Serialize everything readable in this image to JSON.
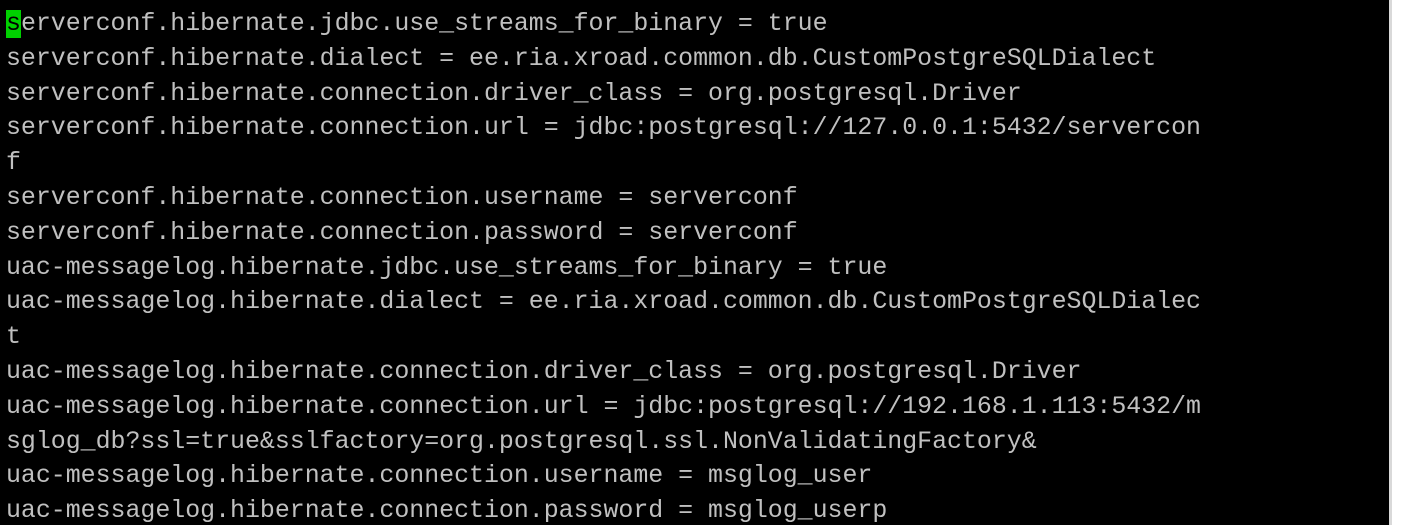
{
  "terminal": {
    "cursor_char": "s",
    "lines": [
      "erverconf.hibernate.jdbc.use_streams_for_binary = true",
      "serverconf.hibernate.dialect = ee.ria.xroad.common.db.CustomPostgreSQLDialect",
      "serverconf.hibernate.connection.driver_class = org.postgresql.Driver",
      "serverconf.hibernate.connection.url = jdbc:postgresql://127.0.0.1:5432/servercon",
      "f",
      "serverconf.hibernate.connection.username = serverconf",
      "serverconf.hibernate.connection.password = serverconf",
      "uac-messagelog.hibernate.jdbc.use_streams_for_binary = true",
      "uac-messagelog.hibernate.dialect = ee.ria.xroad.common.db.CustomPostgreSQLDialec",
      "t",
      "uac-messagelog.hibernate.connection.driver_class = org.postgresql.Driver",
      "uac-messagelog.hibernate.connection.url = jdbc:postgresql://192.168.1.113:5432/m",
      "sglog_db?ssl=true&sslfactory=org.postgresql.ssl.NonValidatingFactory&",
      "uac-messagelog.hibernate.connection.username = msglog_user",
      "uac-messagelog.hibernate.connection.password = msglog_userp"
    ]
  },
  "colors": {
    "background": "#000000",
    "text": "#c0c0c0",
    "cursor": "#00d000"
  }
}
